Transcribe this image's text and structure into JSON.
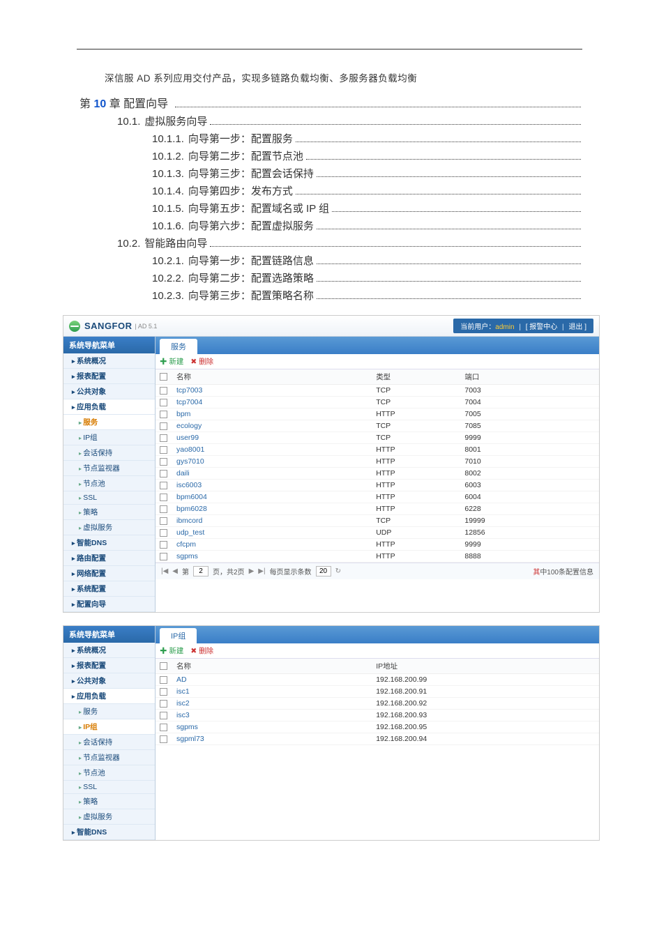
{
  "intro": "深信服 AD 系列应用交付产品，实现多链路负载均衡、多服务器负载均衡",
  "toc": {
    "chapter_prefix": "第 ",
    "chapter_num": "10",
    "chapter_suffix": " 章",
    "chapter_title": "  配置向导",
    "sections": [
      {
        "num": "10.1.",
        "title": "虚拟服务向导",
        "subs": [
          {
            "num": "10.1.1.",
            "title": "向导第一步：配置服务"
          },
          {
            "num": "10.1.2.",
            "title": "向导第二步：配置节点池"
          },
          {
            "num": "10.1.3.",
            "title": "向导第三步：配置会话保持"
          },
          {
            "num": "10.1.4.",
            "title": "向导第四步：发布方式"
          },
          {
            "num": "10.1.5.",
            "title": "向导第五步：配置域名或 IP 组"
          },
          {
            "num": "10.1.6.",
            "title": "向导第六步：配置虚拟服务"
          }
        ]
      },
      {
        "num": "10.2.",
        "title": "智能路由向导",
        "subs": [
          {
            "num": "10.2.1.",
            "title": "向导第一步：配置链路信息"
          },
          {
            "num": "10.2.2.",
            "title": "向导第二步：配置选路策略"
          },
          {
            "num": "10.2.3.",
            "title": "向导第三步：配置策略名称"
          }
        ]
      }
    ]
  },
  "app1": {
    "brand": "SANGFOR",
    "brand_sub": "| AD 5.1",
    "header_user_label": "当前用户：",
    "header_user": "admin",
    "header_alarm": "[ 报警中心",
    "header_logout": "退出 ]",
    "side_title": "系统导航菜单",
    "side_items": [
      {
        "t": "系统概况",
        "cls": "lvl1"
      },
      {
        "t": "报表配置",
        "cls": "lvl1"
      },
      {
        "t": "公共对象",
        "cls": "lvl1"
      },
      {
        "t": "应用负载",
        "cls": "lvl1 expanded"
      },
      {
        "t": "服务",
        "cls": "sub active"
      },
      {
        "t": "IP组",
        "cls": "sub"
      },
      {
        "t": "会话保持",
        "cls": "sub"
      },
      {
        "t": "节点监视器",
        "cls": "sub"
      },
      {
        "t": "节点池",
        "cls": "sub"
      },
      {
        "t": "SSL",
        "cls": "sub"
      },
      {
        "t": "策略",
        "cls": "sub"
      },
      {
        "t": "虚拟服务",
        "cls": "sub"
      },
      {
        "t": "智能DNS",
        "cls": "lvl1"
      },
      {
        "t": "路由配置",
        "cls": "lvl1"
      },
      {
        "t": "网络配置",
        "cls": "lvl1"
      },
      {
        "t": "系统配置",
        "cls": "lvl1"
      },
      {
        "t": "配置向导",
        "cls": "lvl1"
      }
    ],
    "tab": "服务",
    "tool_add": "新建",
    "tool_del": "删除",
    "cols": [
      "",
      "名称",
      "类型",
      "端口"
    ],
    "rows": [
      [
        "tcp7003",
        "TCP",
        "7003"
      ],
      [
        "tcp7004",
        "TCP",
        "7004"
      ],
      [
        "bpm",
        "HTTP",
        "7005"
      ],
      [
        "ecology",
        "TCP",
        "7085"
      ],
      [
        "user99",
        "TCP",
        "9999"
      ],
      [
        "yao8001",
        "HTTP",
        "8001"
      ],
      [
        "gys7010",
        "HTTP",
        "7010"
      ],
      [
        "daili",
        "HTTP",
        "8002"
      ],
      [
        "isc6003",
        "HTTP",
        "6003"
      ],
      [
        "bpm6004",
        "HTTP",
        "6004"
      ],
      [
        "bpm6028",
        "HTTP",
        "6228"
      ],
      [
        "ibmcord",
        "TCP",
        "19999"
      ],
      [
        "udp_test",
        "UDP",
        "12856"
      ],
      [
        "cfcpm",
        "HTTP",
        "9999"
      ],
      [
        "sgpms",
        "HTTP",
        "8888"
      ]
    ],
    "pager": {
      "page_label_pre": "第",
      "page": "2",
      "page_label_post": "页，共2页",
      "per_label": "每页显示条数",
      "per": "20",
      "status_red": "其",
      "status_black": "中100条配置信息",
      "first": "|◀",
      "prev": "◀",
      "next": "▶",
      "last": "▶|",
      "refresh": "↻"
    }
  },
  "app2": {
    "side_title": "系统导航菜单",
    "side_items": [
      {
        "t": "系统概况",
        "cls": "lvl1"
      },
      {
        "t": "报表配置",
        "cls": "lvl1"
      },
      {
        "t": "公共对象",
        "cls": "lvl1"
      },
      {
        "t": "应用负载",
        "cls": "lvl1 expanded"
      },
      {
        "t": "服务",
        "cls": "sub"
      },
      {
        "t": "IP组",
        "cls": "sub active"
      },
      {
        "t": "会话保持",
        "cls": "sub"
      },
      {
        "t": "节点监视器",
        "cls": "sub"
      },
      {
        "t": "节点池",
        "cls": "sub"
      },
      {
        "t": "SSL",
        "cls": "sub"
      },
      {
        "t": "策略",
        "cls": "sub"
      },
      {
        "t": "虚拟服务",
        "cls": "sub"
      },
      {
        "t": "智能DNS",
        "cls": "lvl1"
      }
    ],
    "tab": "IP组",
    "tool_add": "新建",
    "tool_del": "删除",
    "cols": [
      "",
      "名称",
      "IP地址"
    ],
    "rows": [
      [
        "AD",
        "192.168.200.99"
      ],
      [
        "isc1",
        "192.168.200.91"
      ],
      [
        "isc2",
        "192.168.200.92"
      ],
      [
        "isc3",
        "192.168.200.93"
      ],
      [
        "sgpms",
        "192.168.200.95"
      ],
      [
        "sgpml73",
        "192.168.200.94"
      ]
    ]
  }
}
